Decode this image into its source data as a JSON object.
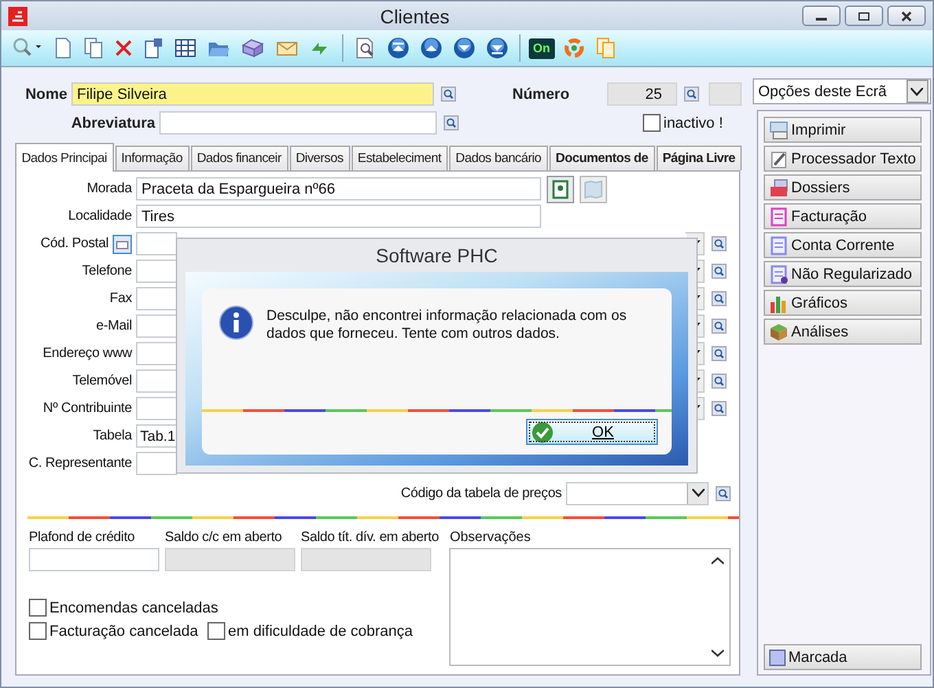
{
  "window": {
    "title": "Clientes"
  },
  "toolbar": {
    "on_badge": "On"
  },
  "header": {
    "nome": {
      "label": "Nome",
      "value": "Filipe Silveira"
    },
    "abreviatura": {
      "label": "Abreviatura"
    },
    "numero": {
      "label": "Número",
      "value": "25"
    },
    "inactivo": {
      "label": "inactivo !",
      "checked": false
    }
  },
  "tabs": [
    {
      "label": "Dados Principai",
      "selected": true
    },
    {
      "label": "Informação",
      "selected": false
    },
    {
      "label": "Dados financeir",
      "selected": false
    },
    {
      "label": "Diversos",
      "selected": false
    },
    {
      "label": "Estabeleciment",
      "selected": false
    },
    {
      "label": "Dados bancário",
      "selected": false
    },
    {
      "label": "Documentos de",
      "selected": false
    },
    {
      "label": "Página Livre",
      "selected": false
    }
  ],
  "fields": [
    {
      "label": "Morada",
      "value": "Praceta da Espargueira nº66",
      "kind": "address"
    },
    {
      "label": "Localidade",
      "value": "Tires",
      "kind": "text"
    },
    {
      "label": "Cód. Postal",
      "kind": "postal"
    },
    {
      "label": "Telefone",
      "kind": "combo"
    },
    {
      "label": "Fax",
      "kind": "combo"
    },
    {
      "label": "e-Mail",
      "kind": "combo"
    },
    {
      "label": "Endereço www",
      "kind": "combo"
    },
    {
      "label": "Telemóvel",
      "kind": "combo"
    },
    {
      "label": "Nº Contribuinte",
      "kind": "combo"
    },
    {
      "label": "Tabela",
      "value": "Tab.1",
      "kind": "short"
    },
    {
      "label": "C. Representante",
      "kind": "short"
    }
  ],
  "price_table": {
    "label": "Código da tabela de preços"
  },
  "balances": [
    {
      "label": "Plafond de crédito",
      "disabled": false
    },
    {
      "label": "Saldo c/c em aberto",
      "disabled": true
    },
    {
      "label": "Saldo tít. dív. em aberto",
      "disabled": true
    }
  ],
  "observations": {
    "label": "Observações"
  },
  "checkboxes": [
    {
      "label": "Encomendas canceladas",
      "checked": false
    },
    {
      "label": "Facturação cancelada",
      "checked": false
    },
    {
      "label": "em dificuldade de cobrança",
      "checked": false
    }
  ],
  "side": {
    "dropdown": "Opções deste Ecrã",
    "buttons": [
      "Imprimir",
      "Processador Texto",
      "Dossiers",
      "Facturação",
      "Conta Corrente",
      "Não Regularizado",
      "Gráficos",
      "Análises"
    ],
    "bottom_button": "Marcada"
  },
  "dialog": {
    "title": "Software PHC",
    "message": "Desculpe, não encontrei informação relacionada com os dados que forneceu. Tente com outros dados.",
    "button": "OK"
  }
}
